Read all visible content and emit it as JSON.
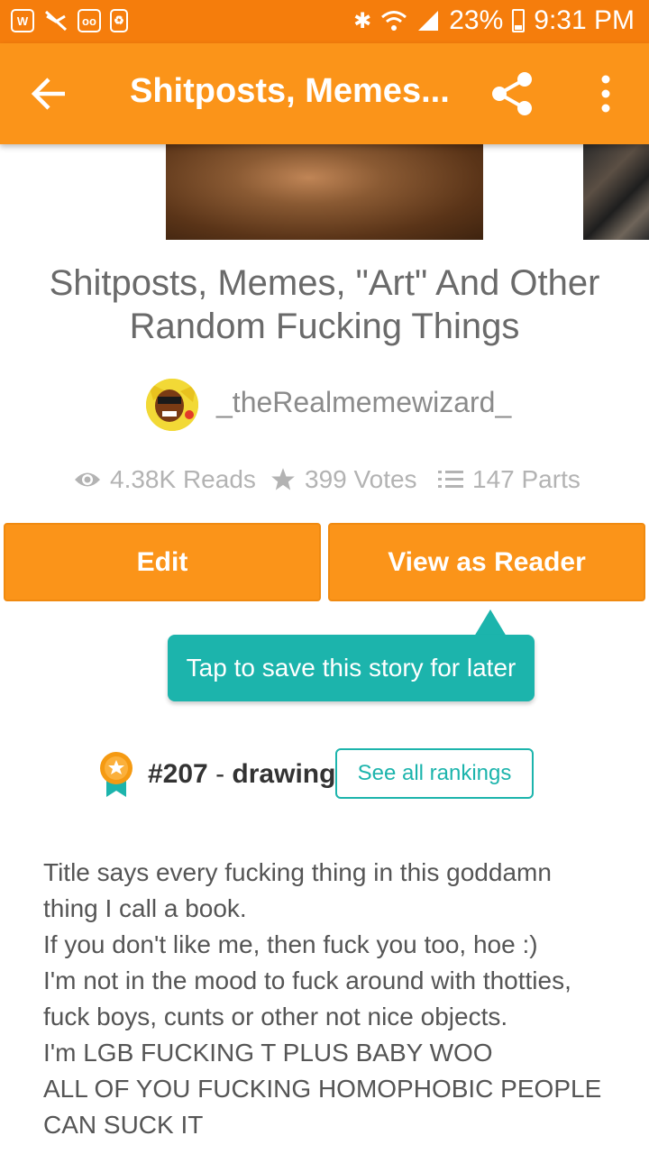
{
  "status_bar": {
    "left_icons": [
      "wattpad-icon",
      "no-sync-icon",
      "voicemail-icon",
      "recycle-icon"
    ],
    "battery": "23%",
    "time": "9:31 PM"
  },
  "app_bar": {
    "title": "Shitposts, Memes..."
  },
  "story": {
    "title": "Shitposts, Memes, \"Art\" And Other Random Fucking Things",
    "author": "_theRealmemewizard_",
    "stats": {
      "reads": "4.38K Reads",
      "votes": "399 Votes",
      "parts": "147 Parts"
    }
  },
  "actions": {
    "edit_label": "Edit",
    "reader_label": "View as Reader"
  },
  "tooltip": "Tap to save this story for later",
  "ranking": {
    "rank": "#207",
    "separator": " - ",
    "tag": "drawing",
    "see_all_label": "See all rankings"
  },
  "description": [
    "Title says every fucking thing in this goddamn",
    "thing I call a book.",
    "If you don't like me, then fuck you too, hoe :)",
    "I'm not in the mood to fuck around with thotties,",
    "fuck boys, cunts or other not nice objects.",
    "I'm LGB FUCKING T PLUS BABY WOO",
    "ALL OF YOU FUCKING HOMOPHOBIC PEOPLE",
    "CAN SUCK IT"
  ],
  "colors": {
    "status_bar": "#f57d0c",
    "app_bar": "#fb9419",
    "accent_teal": "#1cb4ac"
  }
}
